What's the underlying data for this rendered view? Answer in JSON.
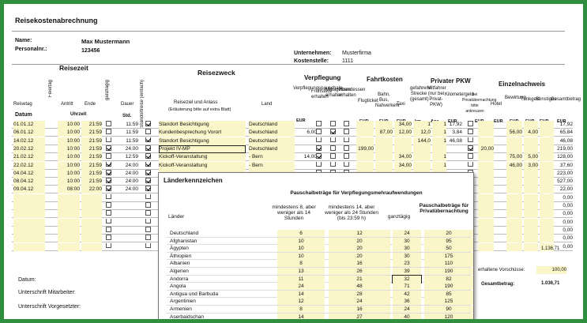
{
  "title": "Reisekostenabrechnung",
  "header": {
    "name_label": "Name:",
    "name_value": "Max Mustermann",
    "pers_label": "Personalnr.:",
    "pers_value": "123456",
    "company_label": "Unternehmen:",
    "company_value": "Musterfirma",
    "cost_label": "Kostenstelle:",
    "cost_value": "1111"
  },
  "sections": {
    "reisezeit": "Reisezeit",
    "reisezweck": "Reisezweck",
    "verpflegung": "Verpflegung",
    "fahrtkosten": "Fahrtkosten",
    "pkw": "Privater PKW",
    "einzel": "Einzelnachweis"
  },
  "cols": {
    "reisetag": "Reisetag",
    "feiertag": "Feiertag",
    "antritt": "Antritt",
    "ende": "Ende",
    "ganztaegig": "ganztägig",
    "dauer": "Dauer",
    "standort": "Standortreise (einfach)",
    "reiseziel": "Reiseziel und Anlass",
    "reiseziel_note": "(Erläuterung bitte auf extra Blatt)",
    "land": "Land",
    "verpfl": "Verpflegungspauschale",
    "fruehst": "Frühstück erhalten",
    "mittag": "Mittagessen erhalten",
    "abend": "Abendessen erhalten",
    "flug": "Flugticket",
    "bahn": "Bahn, Bus, Nahverkehr",
    "taxi": "Taxi",
    "strecke": "gefahrene Strecke (gesamt)",
    "mitfahrer": "Mitfahrer (nur bei Privat-PKW)",
    "kmgeld": "Kilometergeld",
    "privat": "bei Privatübernachtung bitte ankreuzen",
    "hotel": "Hotel",
    "bewirtung": "Bewirtung",
    "trink": "Trinkgeld",
    "sonst": "Sonstiges",
    "gesamt": "Gesamtbetrag"
  },
  "units": {
    "datum": "Datum",
    "uhrzeit": "Uhrzeit",
    "std": "Std.",
    "eur": "EUR",
    "km": "km",
    "anz": "Anz."
  },
  "rows": [
    {
      "date": "01.01.12",
      "start": "10:00",
      "end": "21:59",
      "ganz": false,
      "dauer": "11:59",
      "standort": true,
      "ziel": "Standort Besichtigung",
      "land": "Deutschland",
      "pausch": "",
      "f": false,
      "m": false,
      "a": false,
      "flug": "",
      "bahn": "",
      "taxi": "34,00",
      "km": "1",
      "mit": "1",
      "kmgeld": "17,92",
      "priv": false,
      "hotel": "",
      "bew": "",
      "trink": "",
      "sonst": "",
      "total": "17,92"
    },
    {
      "date": "06.01.12",
      "start": "10:00",
      "end": "21:59",
      "ganz": false,
      "dauer": "11:59",
      "standort": false,
      "ziel": "Kundenbesprechung Vorort",
      "land": "Deutschland",
      "pausch": "6,00",
      "f": false,
      "m": true,
      "a": false,
      "flug": "",
      "bahn": "87,00",
      "taxi": "12,00",
      "km": "12,0",
      "mit": "1",
      "kmgeld": "3,84",
      "priv": false,
      "hotel": "",
      "bew": "56,00",
      "trink": "4,00",
      "sonst": "",
      "total": "65,84"
    },
    {
      "date": "14.02.12",
      "start": "10:00",
      "end": "21:59",
      "ganz": false,
      "dauer": "11:59",
      "standort": true,
      "ziel": "Standort Besichtigung",
      "land": "Deutschland",
      "pausch": "",
      "f": false,
      "m": false,
      "a": false,
      "flug": "",
      "bahn": "",
      "taxi": "",
      "km": "144,0",
      "mit": "1",
      "kmgeld": "46,08",
      "priv": false,
      "hotel": "",
      "bew": "",
      "trink": "",
      "sonst": "",
      "total": "46,08"
    },
    {
      "date": "20.02.12",
      "start": "10:00",
      "end": "21:59",
      "ganz": true,
      "dauer": "24:00",
      "standort": true,
      "ziel": "Projekt IV-MP",
      "land": "Deutschland",
      "pausch": "",
      "f": true,
      "m": false,
      "a": false,
      "flug": "199,00",
      "bahn": "",
      "taxi": "",
      "km": "",
      "mit": "",
      "kmgeld": "",
      "priv": true,
      "hotel": "20,00",
      "bew": "",
      "trink": "",
      "sonst": "",
      "total": "219,00"
    },
    {
      "date": "21.02.12",
      "start": "10:00",
      "end": "21:59",
      "ganz": false,
      "dauer": "12:59",
      "standort": true,
      "ziel": "Kickoff-Veranstaltung",
      "land": "- Bern",
      "pausch": "14,00",
      "f": true,
      "m": false,
      "a": false,
      "flug": "",
      "bahn": "",
      "taxi": "34,00",
      "km": "",
      "mit": "1",
      "kmgeld": "",
      "priv": false,
      "hotel": "",
      "bew": "75,00",
      "trink": "5,00",
      "sonst": "",
      "total": "128,00"
    },
    {
      "date": "22.02.12",
      "start": "10:00",
      "end": "21:59",
      "ganz": true,
      "dauer": "24:00",
      "standort": true,
      "ziel": "Kickoff-Veranstaltung",
      "land": "- Bern",
      "pausch": "",
      "f": false,
      "m": false,
      "a": false,
      "flug": "",
      "bahn": "",
      "taxi": "34,00",
      "km": "",
      "mit": "1",
      "kmgeld": "",
      "priv": false,
      "hotel": "",
      "bew": "46,00",
      "trink": "3,00",
      "sonst": "",
      "total": "37,60"
    },
    {
      "date": "04.04.12",
      "start": "10:00",
      "end": "21:59",
      "ganz": true,
      "dauer": "24:00",
      "standort": true,
      "ziel": "",
      "land": "",
      "pausch": "",
      "f": false,
      "m": false,
      "a": false,
      "flug": "",
      "bahn": "",
      "taxi": "",
      "km": "",
      "mit": "",
      "kmgeld": "",
      "priv": false,
      "hotel": "",
      "bew": "",
      "trink": "",
      "sonst": "",
      "total": "223,00"
    },
    {
      "date": "08.04.12",
      "start": "10:00",
      "end": "21:59",
      "ganz": true,
      "dauer": "24:00",
      "standort": true,
      "ziel": "",
      "land": "",
      "pausch": "",
      "f": false,
      "m": false,
      "a": false,
      "flug": "",
      "bahn": "",
      "taxi": "",
      "km": "",
      "mit": "",
      "kmgeld": "",
      "priv": false,
      "hotel": "",
      "bew": "",
      "trink": "",
      "sonst": "",
      "total": "527,00"
    },
    {
      "date": "09.04.12",
      "start": "08:00",
      "end": "22:00",
      "ganz": true,
      "dauer": "24:00",
      "standort": true,
      "ziel": "",
      "land": "",
      "pausch": "",
      "f": false,
      "m": false,
      "a": false,
      "flug": "",
      "bahn": "",
      "taxi": "",
      "km": "",
      "mit": "",
      "kmgeld": "",
      "priv": false,
      "hotel": "",
      "bew": "",
      "trink": "",
      "sonst": "",
      "total": "22,00"
    },
    {
      "date": "",
      "start": "",
      "end": "",
      "ganz": false,
      "dauer": "",
      "standort": false,
      "ziel": "",
      "land": "",
      "pausch": "",
      "f": false,
      "m": false,
      "a": false,
      "flug": "",
      "bahn": "",
      "taxi": "",
      "km": "",
      "mit": "",
      "kmgeld": "",
      "priv": false,
      "hotel": "",
      "bew": "",
      "trink": "",
      "sonst": "",
      "total": "0,00"
    },
    {
      "date": "",
      "start": "",
      "end": "",
      "ganz": false,
      "dauer": "",
      "standort": false,
      "ziel": "",
      "land": "",
      "pausch": "",
      "f": false,
      "m": false,
      "a": false,
      "flug": "",
      "bahn": "",
      "taxi": "",
      "km": "",
      "mit": "",
      "kmgeld": "",
      "priv": false,
      "hotel": "",
      "bew": "",
      "trink": "",
      "sonst": "",
      "total": "0,00"
    },
    {
      "date": "",
      "start": "",
      "end": "",
      "ganz": false,
      "dauer": "",
      "standort": false,
      "ziel": "",
      "land": "",
      "pausch": "",
      "f": false,
      "m": false,
      "a": false,
      "flug": "",
      "bahn": "",
      "taxi": "",
      "km": "",
      "mit": "",
      "kmgeld": "",
      "priv": false,
      "hotel": "",
      "bew": "",
      "trink": "",
      "sonst": "",
      "total": "0,00"
    },
    {
      "date": "",
      "start": "",
      "end": "",
      "ganz": false,
      "dauer": "",
      "standort": false,
      "ziel": "",
      "land": "",
      "pausch": "",
      "f": false,
      "m": false,
      "a": false,
      "flug": "",
      "bahn": "",
      "taxi": "",
      "km": "",
      "mit": "",
      "kmgeld": "",
      "priv": false,
      "hotel": "",
      "bew": "",
      "trink": "",
      "sonst": "",
      "total": "0,00"
    },
    {
      "date": "",
      "start": "",
      "end": "",
      "ganz": false,
      "dauer": "",
      "standort": false,
      "ziel": "",
      "land": "",
      "pausch": "",
      "f": false,
      "m": false,
      "a": false,
      "flug": "",
      "bahn": "",
      "taxi": "",
      "km": "",
      "mit": "",
      "kmgeld": "",
      "priv": false,
      "hotel": "",
      "bew": "",
      "trink": "",
      "sonst": "",
      "total": "0,00"
    },
    {
      "date": "",
      "start": "",
      "end": "",
      "ganz": false,
      "dauer": "",
      "standort": false,
      "ziel": "",
      "land": "",
      "pausch": "",
      "f": false,
      "m": false,
      "a": false,
      "flug": "",
      "bahn": "",
      "taxi": "",
      "km": "",
      "mit": "",
      "kmgeld": "",
      "priv": false,
      "hotel": "",
      "bew": "",
      "trink": "",
      "sonst": "",
      "total": "0,00"
    },
    {
      "date": "",
      "start": "",
      "end": "",
      "ganz": false,
      "dauer": "",
      "standort": false,
      "ziel": "",
      "land": "",
      "pausch": "",
      "f": false,
      "m": false,
      "a": false,
      "flug": "",
      "bahn": "",
      "taxi": "",
      "km": "",
      "mit": "",
      "kmgeld": "",
      "priv": false,
      "hotel": "",
      "bew": "",
      "trink": "",
      "sonst": "",
      "total": "0,00"
    }
  ],
  "footer": {
    "datum": "Datum:",
    "sig_employee": "Unterschrift Mitarbeiter:",
    "sig_supervisor": "Unterschrift Vorgesetzter:",
    "vorschuss": "erhaltene Vorschüsse:",
    "vorschuss_value": "100,00",
    "gesamt": "Gesamtbetrag:",
    "gesamt_value": "1.036,71",
    "subtotal": "1.136,71"
  },
  "popup": {
    "title": "Länderkennzeichen",
    "head_pauschal": "Pauschalbeträge für Verpflegungsmehraufwendungen",
    "head_8h": "mindestens 8, aber weniger als 14 Stunden",
    "head_14h": "mindestens 14, aber weniger als 24 Stunden (bis 23:59 h)",
    "head_ganz": "ganztägig",
    "head_ueber": "Pauschalbeträge für Privatübernachtung",
    "head_laender": "Länder",
    "countries": [
      {
        "name": "Deutschland",
        "a": "6",
        "b": "12",
        "c": "24",
        "d": "20"
      },
      {
        "name": "Afghanistan",
        "a": "10",
        "b": "20",
        "c": "30",
        "d": "95"
      },
      {
        "name": "Ägypten",
        "a": "10",
        "b": "20",
        "c": "30",
        "d": "50"
      },
      {
        "name": "Äthiopien",
        "a": "10",
        "b": "20",
        "c": "30",
        "d": "175"
      },
      {
        "name": "Albanien",
        "a": "8",
        "b": "16",
        "c": "23",
        "d": "110"
      },
      {
        "name": "Algerien",
        "a": "13",
        "b": "26",
        "c": "39",
        "d": "190"
      },
      {
        "name": "Andorra",
        "a": "11",
        "b": "21",
        "c": "32",
        "d": "82"
      },
      {
        "name": "Angola",
        "a": "24",
        "b": "48",
        "c": "71",
        "d": "190"
      },
      {
        "name": "Antigua und Barbuda",
        "a": "14",
        "b": "28",
        "c": "42",
        "d": "85"
      },
      {
        "name": "Argentinien",
        "a": "12",
        "b": "24",
        "c": "36",
        "d": "125"
      },
      {
        "name": "Armenien",
        "a": "8",
        "b": "16",
        "c": "24",
        "d": "90"
      },
      {
        "name": "Aserbaidschan",
        "a": "14",
        "b": "27",
        "c": "40",
        "d": "120"
      }
    ]
  }
}
